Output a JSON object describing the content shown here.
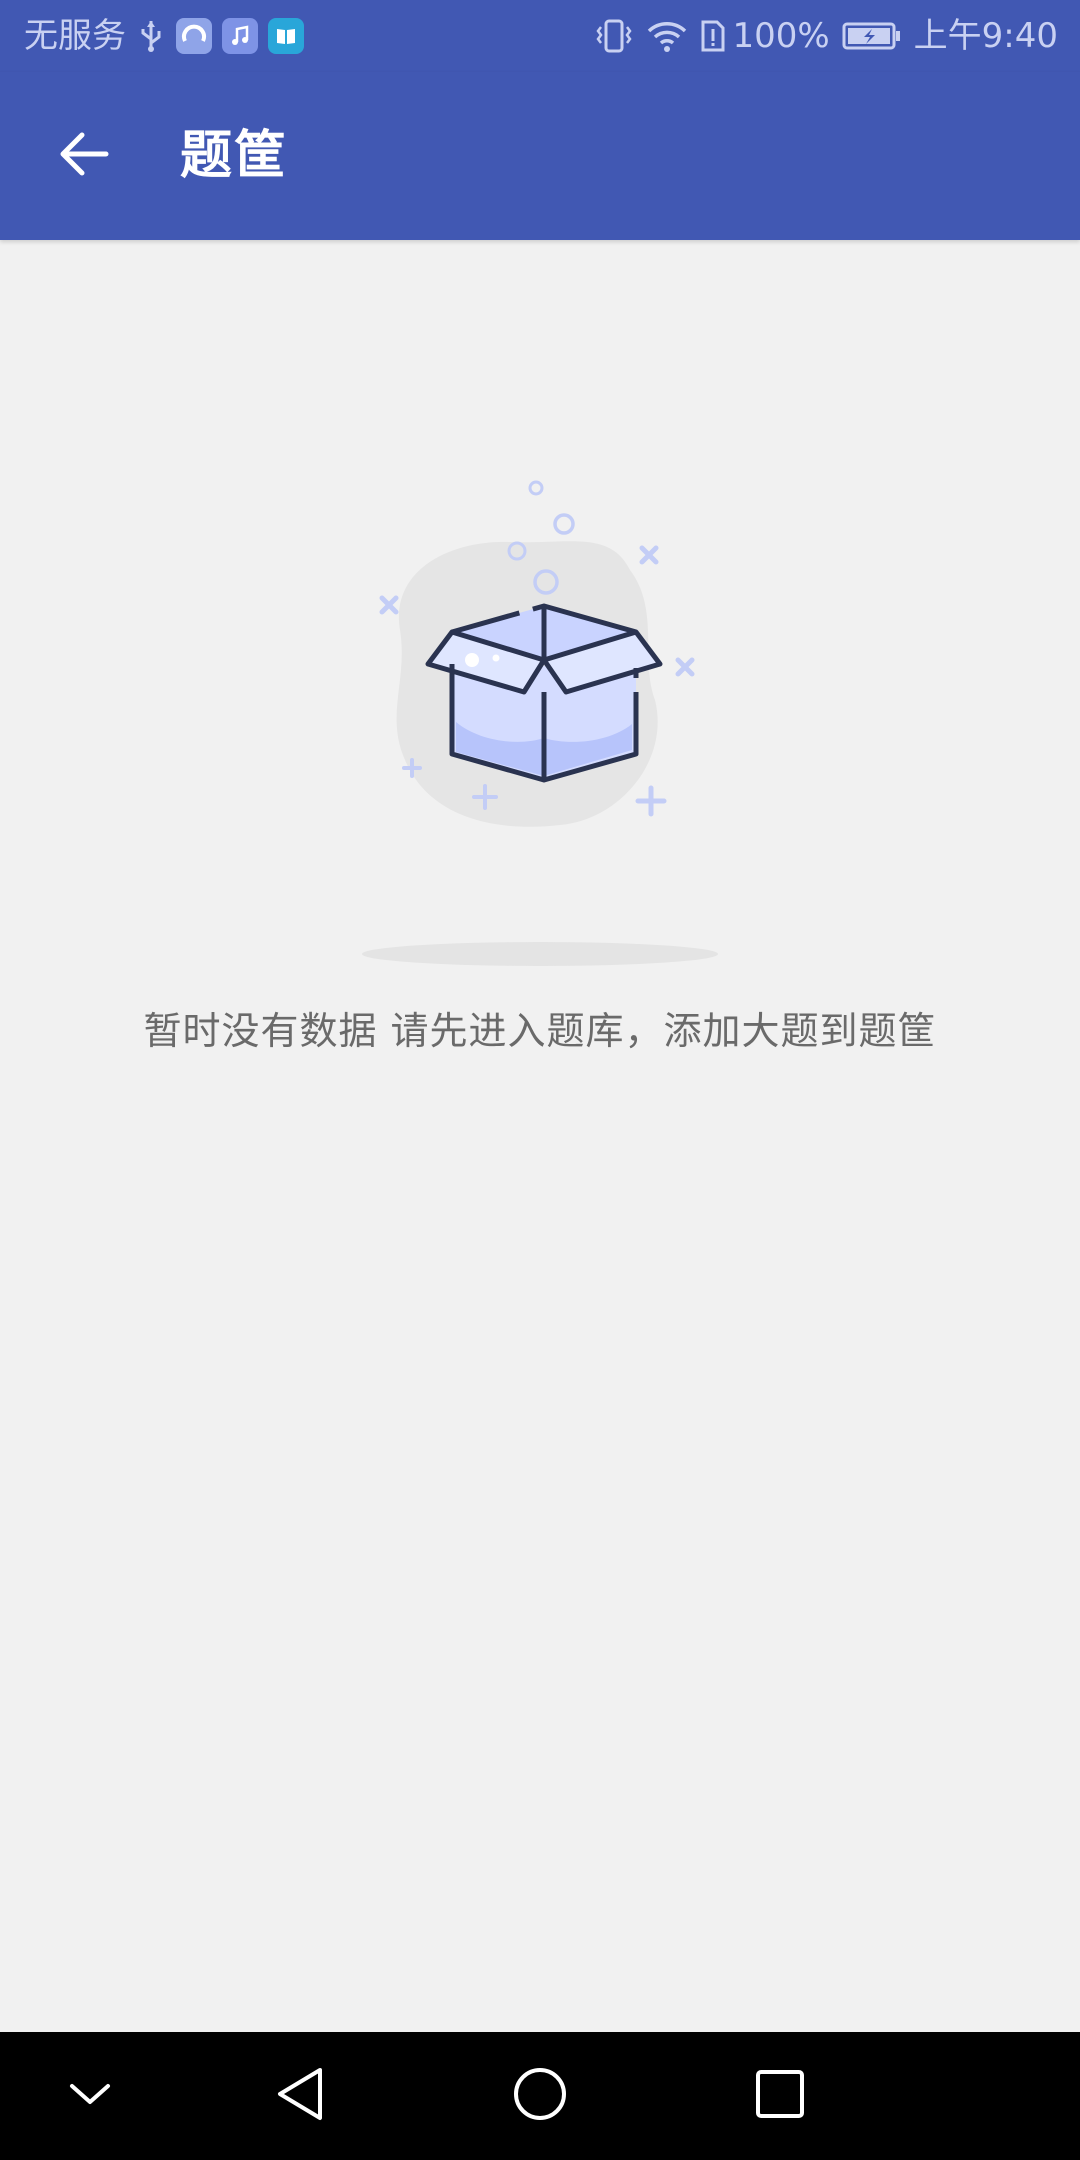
{
  "status_bar": {
    "carrier": "无服务",
    "battery": "100%",
    "time": "上午9:40"
  },
  "app_bar": {
    "title": "题筐",
    "back_icon": "arrow-left-icon"
  },
  "empty_state": {
    "message": "暂时没有数据 请先进入题库，添加大题到题筐",
    "illustration_icon": "empty-box-icon"
  },
  "nav_bar": {
    "icons": [
      "chevron-down-icon",
      "back-triangle-icon",
      "home-circle-icon",
      "recents-square-icon"
    ]
  },
  "colors": {
    "primary": "#4158b3",
    "background": "#f1f1f1",
    "message_text": "#6a6a6a",
    "illustration_accent": "#cfd8ff"
  }
}
